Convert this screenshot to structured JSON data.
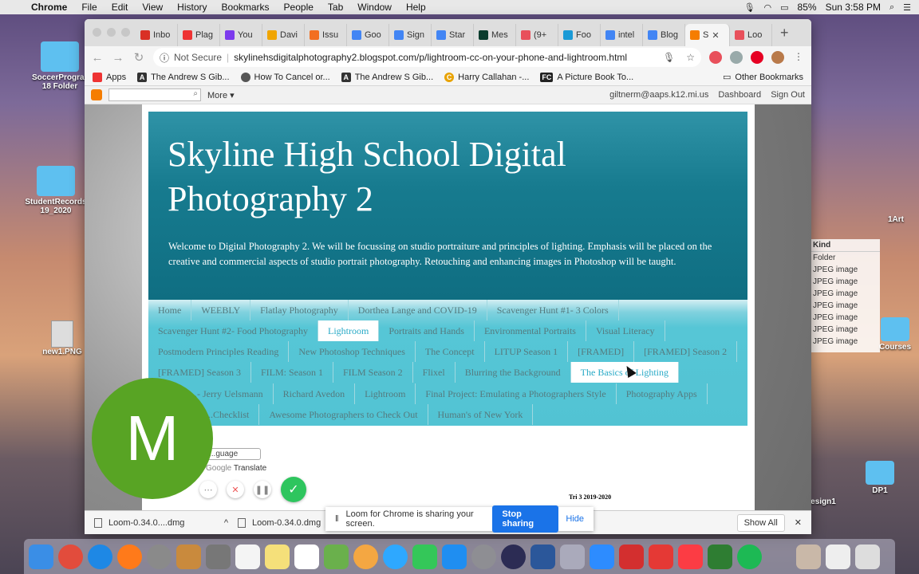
{
  "menubar": {
    "app": "Chrome",
    "items": [
      "File",
      "Edit",
      "View",
      "History",
      "Bookmarks",
      "People",
      "Tab",
      "Window",
      "Help"
    ],
    "battery": "85%",
    "clock": "Sun 3:58 PM"
  },
  "desktop": {
    "left_icons": [
      {
        "label": "SoccerProgram 18 Folder"
      },
      {
        "label": "StudentRecords 19_2020"
      },
      {
        "label": "new1.PNG"
      }
    ],
    "right_labels": [
      "1Art",
      "Courses",
      "DP1",
      "esign1"
    ]
  },
  "tabs": [
    "Inbo",
    "Plag",
    "You",
    "Davi",
    "Issu",
    "Goo",
    "Sign",
    "Star",
    "Mes",
    "(9+",
    "Foo",
    "intel",
    "Blog",
    "S",
    "Loo"
  ],
  "address": {
    "security": "Not Secure",
    "url": "skylinehsdigitalphotography2.blogspot.com/p/lightroom-cc-on-your-phone-and-lightroom.html"
  },
  "bookmarks": [
    {
      "label": "Apps",
      "color": "#888888",
      "glyph": ""
    },
    {
      "label": "The Andrew S Gib...",
      "color": "#333333",
      "glyph": "A"
    },
    {
      "label": "How To Cancel or...",
      "color": "#555555",
      "glyph": ""
    },
    {
      "label": "The Andrew S Gib...",
      "color": "#333333",
      "glyph": "A"
    },
    {
      "label": "Harry Callahan -...",
      "color": "#e8a200",
      "glyph": "C"
    },
    {
      "label": "A Picture Book To...",
      "color": "#222222",
      "glyph": "FC"
    }
  ],
  "other_bookmarks": "Other Bookmarks",
  "blogger_bar": {
    "more": "More",
    "email": "giltnerm@aaps.k12.mi.us",
    "dashboard": "Dashboard",
    "signout": "Sign Out"
  },
  "blog": {
    "title": "Skyline High School Digital Photography 2",
    "description": "Welcome to Digital Photography 2. We will be focussing on studio portraiture and principles of lighting. Emphasis will be placed on the creative and commercial aspects of studio portrait photography. Retouching and enhancing images in Photoshop will be taught.",
    "menu_rows": [
      [
        "Home",
        "WEEBLY",
        "Flatlay Photography",
        "Dorthea Lange and COVID-19",
        "Scavenger Hunt #1- 3 Colors"
      ],
      [
        "Scavenger Hunt #2- Food Photography",
        "Lightroom",
        "Portraits and Hands",
        "Environmental Portraits",
        "Visual Literacy"
      ],
      [
        "Postmodern Principles Reading",
        "New Photoshop Techniques",
        "The Concept",
        "LITUP Season 1",
        "[FRAMED]",
        "[FRAMED] Season 2"
      ],
      [
        "[FRAMED] Season 3",
        "FILM: Season 1",
        "FILM Season 2",
        "Flixel",
        "Blurring the Background",
        "The Basics of Lighting"
      ],
      [
        "...- Jerry Uelsmann",
        "Richard Avedon",
        "Lightroom",
        "Final Project: Emulating a Photographers Style",
        "Photography Apps"
      ],
      [
        "...Checklist",
        "Awesome Photographers to Check Out",
        "Human's of New York"
      ]
    ],
    "selected": "Lightroom",
    "hovered": "The Basics of Lighting",
    "language_select": "...guage",
    "translate": "Translate",
    "google": "Google",
    "term": "Tri 3 2019-2020"
  },
  "loom": {
    "avatar_letter": "M",
    "sharing_text": "Loom for Chrome is sharing your screen.",
    "stop": "Stop sharing",
    "hide": "Hide"
  },
  "downloads": {
    "items": [
      "Loom-0.34.0....dmg",
      "Loom-0.34.0.dmg"
    ],
    "show_all": "Show All"
  },
  "finder": {
    "header": "Kind",
    "rows": [
      "Folder",
      "JPEG image",
      "JPEG image",
      "JPEG image",
      "JPEG image",
      "JPEG image",
      "JPEG image",
      "JPEG image"
    ]
  }
}
